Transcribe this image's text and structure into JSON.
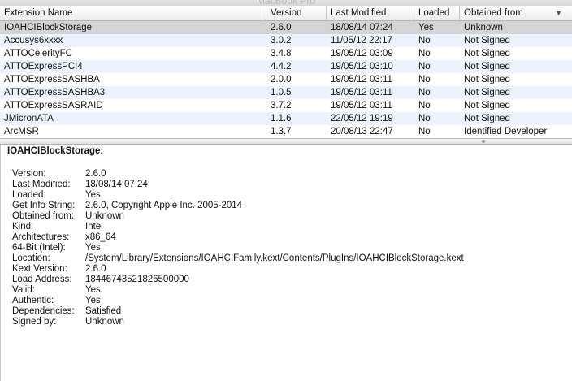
{
  "window": {
    "title": "MacBook Pro"
  },
  "table": {
    "columns": [
      "Extension Name",
      "Version",
      "Last Modified",
      "Loaded",
      "Obtained from"
    ],
    "rows": [
      [
        "IOAHCIBlockStorage",
        "2.6.0",
        "18/08/14 07:24",
        "Yes",
        "Unknown"
      ],
      [
        "Accusys6xxxx",
        "3.0.2",
        "11/05/12 22:17",
        "No",
        "Not Signed"
      ],
      [
        "ATTOCelerityFC",
        "3.4.8",
        "19/05/12 03:09",
        "No",
        "Not Signed"
      ],
      [
        "ATTOExpressPCI4",
        "4.4.2",
        "19/05/12 03:10",
        "No",
        "Not Signed"
      ],
      [
        "ATTOExpressSASHBA",
        "2.0.0",
        "19/05/12 03:11",
        "No",
        "Not Signed"
      ],
      [
        "ATTOExpressSASHBA3",
        "1.0.5",
        "19/05/12 03:11",
        "No",
        "Not Signed"
      ],
      [
        "ATTOExpressSASRAID",
        "3.7.2",
        "19/05/12 03:11",
        "No",
        "Not Signed"
      ],
      [
        "JMicronATA",
        "1.1.6",
        "22/05/12 19:19",
        "No",
        "Not Signed"
      ],
      [
        "ArcMSR",
        "1.3.7",
        "20/08/13 22:47",
        "No",
        "Identified Developer"
      ]
    ]
  },
  "detail": {
    "title": "IOAHCIBlockStorage:",
    "properties": [
      [
        "Version:",
        "2.6.0"
      ],
      [
        "Last Modified:",
        "18/08/14 07:24"
      ],
      [
        "Loaded:",
        "Yes"
      ],
      [
        "Get Info String:",
        "2.6.0, Copyright Apple Inc. 2005-2014"
      ],
      [
        "Obtained from:",
        "Unknown"
      ],
      [
        "Kind:",
        "Intel"
      ],
      [
        "Architectures:",
        "x86_64"
      ],
      [
        "64-Bit (Intel):",
        "Yes"
      ],
      [
        "Location:",
        "/System/Library/Extensions/IOAHCIFamily.kext/Contents/PlugIns/IOAHCIBlockStorage.kext"
      ],
      [
        "Kext Version:",
        "2.6.0"
      ],
      [
        "Load Address:",
        "18446743521826500000"
      ],
      [
        "Valid:",
        "Yes"
      ],
      [
        "Authentic:",
        "Yes"
      ],
      [
        "Dependencies:",
        "Satisfied"
      ],
      [
        "Signed by:",
        "Unknown"
      ]
    ]
  }
}
